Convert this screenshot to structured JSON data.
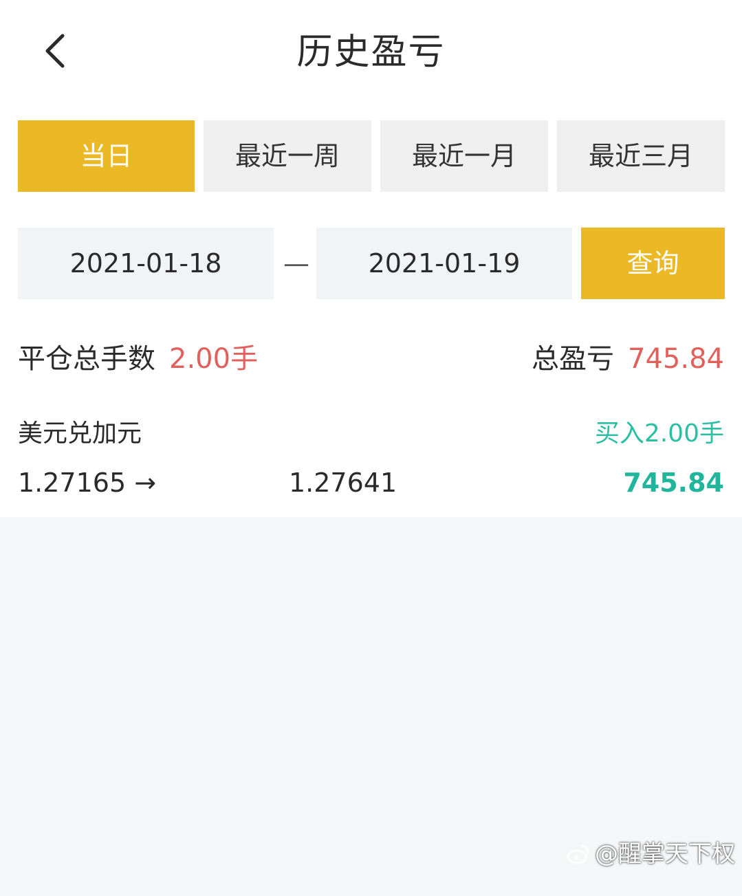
{
  "header": {
    "title": "历史盈亏"
  },
  "tabs": [
    {
      "label": "当日",
      "active": true
    },
    {
      "label": "最近一周",
      "active": false
    },
    {
      "label": "最近一月",
      "active": false
    },
    {
      "label": "最近三月",
      "active": false
    }
  ],
  "date_range": {
    "start": "2021-01-18",
    "separator": "—",
    "end": "2021-01-19",
    "query_label": "查询"
  },
  "summary": {
    "closed_lots_label": "平仓总手数",
    "closed_lots_value": "2.00手",
    "total_pnl_label": "总盈亏",
    "total_pnl_value": "745.84"
  },
  "trades": [
    {
      "symbol": "美元兑加元",
      "side": "买入2.00手",
      "open_price": "1.27165",
      "arrow": "→",
      "close_price": "1.27641",
      "pnl": "745.84"
    }
  ],
  "watermark": {
    "text": "@醒掌天下权"
  },
  "colors": {
    "accent": "#ebb926",
    "loss_red": "#e0605b",
    "profit_green": "#21b59b",
    "background": "#f4f6f8"
  }
}
